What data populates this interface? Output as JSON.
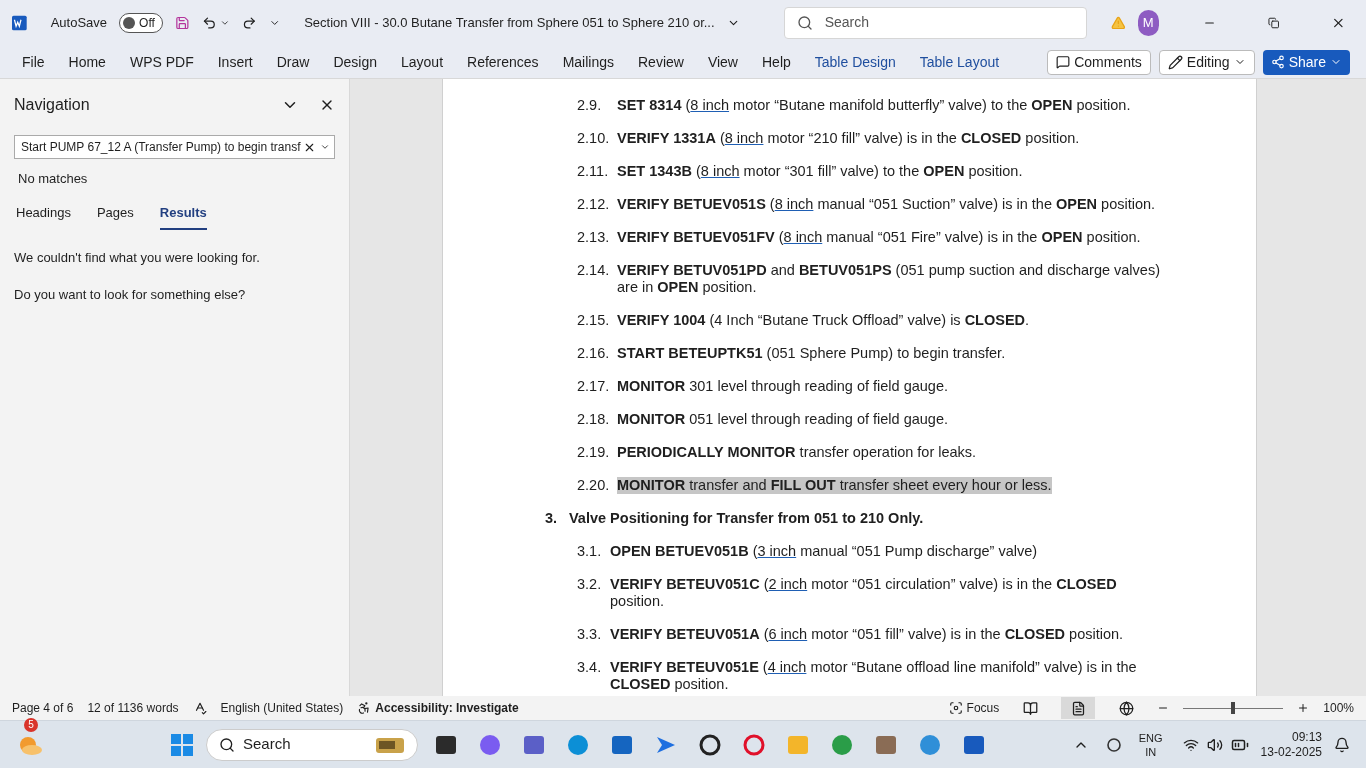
{
  "titlebar": {
    "autosave_label": "AutoSave",
    "autosave_on": false,
    "autosave_state": "Off",
    "title": "Section VIII - 30.0 Butane Transfer from Sphere 051 to Sphere 210 or...",
    "search_placeholder": "Search",
    "avatar": "M"
  },
  "ribbon_tabs": [
    {
      "label": "File",
      "contextual": false
    },
    {
      "label": "Home",
      "contextual": false
    },
    {
      "label": "WPS PDF",
      "contextual": false
    },
    {
      "label": "Insert",
      "contextual": false
    },
    {
      "label": "Draw",
      "contextual": false
    },
    {
      "label": "Design",
      "contextual": false
    },
    {
      "label": "Layout",
      "contextual": false
    },
    {
      "label": "References",
      "contextual": false
    },
    {
      "label": "Mailings",
      "contextual": false
    },
    {
      "label": "Review",
      "contextual": false
    },
    {
      "label": "View",
      "contextual": false
    },
    {
      "label": "Help",
      "contextual": false
    },
    {
      "label": "Table Design",
      "contextual": true
    },
    {
      "label": "Table Layout",
      "contextual": true
    }
  ],
  "ribbon_buttons": {
    "comments": "Comments",
    "editing": "Editing",
    "share": "Share"
  },
  "navigation": {
    "title": "Navigation",
    "search_value": "Start PUMP 67_12 A (Transfer Pump) to begin transf",
    "status": "No matches",
    "tabs": [
      {
        "label": "Headings",
        "selected": false
      },
      {
        "label": "Pages",
        "selected": false
      },
      {
        "label": "Results",
        "selected": true
      }
    ],
    "messages": [
      "We couldn't find what you were looking for.",
      "Do you want to look for something else?"
    ]
  },
  "document": {
    "steps": [
      {
        "number": "2.9.",
        "highlighted": false,
        "segments": [
          {
            "t": "SET 8314",
            "bold": true,
            "underline": false
          },
          {
            "t": " (",
            "bold": false,
            "underline": false
          },
          {
            "t": "8 inch",
            "bold": false,
            "underline": true
          },
          {
            "t": " motor “Butane manifold butterfly” valve) to the ",
            "bold": false,
            "underline": false
          },
          {
            "t": "OPEN",
            "bold": true,
            "underline": false
          },
          {
            "t": " position.",
            "bold": false,
            "underline": false
          }
        ]
      },
      {
        "number": "2.10.",
        "highlighted": false,
        "segments": [
          {
            "t": "VERIFY 1331A",
            "bold": true,
            "underline": false
          },
          {
            "t": " (",
            "bold": false,
            "underline": false
          },
          {
            "t": "8 inch",
            "bold": false,
            "underline": true
          },
          {
            "t": " motor “210 fill” valve) is in the ",
            "bold": false,
            "underline": false
          },
          {
            "t": "CLOSED",
            "bold": true,
            "underline": false
          },
          {
            "t": " position.",
            "bold": false,
            "underline": false
          }
        ]
      },
      {
        "number": "2.11.",
        "highlighted": false,
        "segments": [
          {
            "t": "SET 1343B",
            "bold": true,
            "underline": false
          },
          {
            "t": " (",
            "bold": false,
            "underline": false
          },
          {
            "t": "8 inch",
            "bold": false,
            "underline": true
          },
          {
            "t": " motor “301 fill” valve) to the ",
            "bold": false,
            "underline": false
          },
          {
            "t": "OPEN",
            "bold": true,
            "underline": false
          },
          {
            "t": " position.",
            "bold": false,
            "underline": false
          }
        ]
      },
      {
        "number": "2.12.",
        "highlighted": false,
        "segments": [
          {
            "t": "VERIFY BETUEV051S",
            "bold": true,
            "underline": false
          },
          {
            "t": " (",
            "bold": false,
            "underline": false
          },
          {
            "t": "8 inch",
            "bold": false,
            "underline": true
          },
          {
            "t": " manual “051 Suction” valve) is in the ",
            "bold": false,
            "underline": false
          },
          {
            "t": "OPEN",
            "bold": true,
            "underline": false
          },
          {
            "t": " position.",
            "bold": false,
            "underline": false
          }
        ]
      },
      {
        "number": "2.13.",
        "highlighted": false,
        "segments": [
          {
            "t": "VERIFY BETUEV051FV",
            "bold": true,
            "underline": false
          },
          {
            "t": " (",
            "bold": false,
            "underline": false
          },
          {
            "t": "8 inch",
            "bold": false,
            "underline": true
          },
          {
            "t": " manual “051 Fire” valve) is in the ",
            "bold": false,
            "underline": false
          },
          {
            "t": "OPEN",
            "bold": true,
            "underline": false
          },
          {
            "t": " position.",
            "bold": false,
            "underline": false
          }
        ]
      },
      {
        "number": "2.14.",
        "highlighted": false,
        "segments": [
          {
            "t": "VERIFY BETUV051PD",
            "bold": true,
            "underline": false
          },
          {
            "t": " and ",
            "bold": false,
            "underline": false
          },
          {
            "t": "BETUV051PS",
            "bold": true,
            "underline": false
          },
          {
            "t": " (051 pump suction and discharge valves) are in ",
            "bold": false,
            "underline": false
          },
          {
            "t": "OPEN",
            "bold": true,
            "underline": false
          },
          {
            "t": " position.",
            "bold": false,
            "underline": false
          }
        ]
      },
      {
        "number": "2.15.",
        "highlighted": false,
        "segments": [
          {
            "t": "VERIFY 1004",
            "bold": true,
            "underline": false
          },
          {
            "t": " (4 Inch “Butane Truck Offload” valve) is ",
            "bold": false,
            "underline": false
          },
          {
            "t": "CLOSED",
            "bold": true,
            "underline": false
          },
          {
            "t": ".",
            "bold": false,
            "underline": false
          }
        ]
      },
      {
        "number": "2.16.",
        "highlighted": false,
        "segments": [
          {
            "t": "START BETEUPTK51",
            "bold": true,
            "underline": false
          },
          {
            "t": " (051 Sphere Pump) to begin transfer.",
            "bold": false,
            "underline": false
          }
        ]
      },
      {
        "number": "2.17.",
        "highlighted": false,
        "segments": [
          {
            "t": "MONITOR",
            "bold": true,
            "underline": false
          },
          {
            "t": " 301 level through reading of field gauge.",
            "bold": false,
            "underline": false
          }
        ]
      },
      {
        "number": "2.18.",
        "highlighted": false,
        "segments": [
          {
            "t": "MONITOR",
            "bold": true,
            "underline": false
          },
          {
            "t": " 051 level through reading of field gauge.",
            "bold": false,
            "underline": false
          }
        ]
      },
      {
        "number": "2.19.",
        "highlighted": false,
        "segments": [
          {
            "t": "PERIODICALLY MONITOR",
            "bold": true,
            "underline": false
          },
          {
            "t": " transfer operation for leaks.",
            "bold": false,
            "underline": false
          }
        ]
      },
      {
        "number": "2.20.",
        "highlighted": true,
        "segments": [
          {
            "t": "MONITOR",
            "bold": true,
            "underline": false
          },
          {
            "t": " transfer and ",
            "bold": false,
            "underline": false
          },
          {
            "t": "FILL OUT",
            "bold": true,
            "underline": false
          },
          {
            "t": " transfer sheet every hour or less.",
            "bold": false,
            "underline": false
          }
        ]
      }
    ],
    "section": {
      "number": "3.",
      "title": "Valve Positioning for Transfer from 051 to 210 Only."
    },
    "section_steps": [
      {
        "number": "3.1.",
        "highlighted": false,
        "segments": [
          {
            "t": "OPEN BETUEV051B",
            "bold": true,
            "underline": false
          },
          {
            "t": " (",
            "bold": false,
            "underline": false
          },
          {
            "t": "3 inch",
            "bold": false,
            "underline": true
          },
          {
            "t": " manual “051 Pump discharge” valve)",
            "bold": false,
            "underline": false
          }
        ]
      },
      {
        "number": "3.2.",
        "highlighted": false,
        "segments": [
          {
            "t": "VERIFY BETEUV051C",
            "bold": true,
            "underline": false
          },
          {
            "t": " (",
            "bold": false,
            "underline": false
          },
          {
            "t": "2 inch",
            "bold": false,
            "underline": true
          },
          {
            "t": " motor “051 circulation” valve) is in the ",
            "bold": false,
            "underline": false
          },
          {
            "t": "CLOSED",
            "bold": true,
            "underline": false
          },
          {
            "t": " position.",
            "bold": false,
            "underline": false
          }
        ]
      },
      {
        "number": "3.3.",
        "highlighted": false,
        "segments": [
          {
            "t": "VERIFY BETEUV051A",
            "bold": true,
            "underline": false
          },
          {
            "t": " (",
            "bold": false,
            "underline": false
          },
          {
            "t": "6 inch",
            "bold": false,
            "underline": true
          },
          {
            "t": " motor “051 fill” valve) is in the ",
            "bold": false,
            "underline": false
          },
          {
            "t": "CLOSED",
            "bold": true,
            "underline": false
          },
          {
            "t": " position.",
            "bold": false,
            "underline": false
          }
        ]
      },
      {
        "number": "3.4.",
        "highlighted": false,
        "segments": [
          {
            "t": "VERIFY BETEUV051E",
            "bold": true,
            "underline": false
          },
          {
            "t": " (",
            "bold": false,
            "underline": false
          },
          {
            "t": "4 inch",
            "bold": false,
            "underline": true
          },
          {
            "t": " motor “Butane offload line manifold” valve) is in the ",
            "bold": false,
            "underline": false
          },
          {
            "t": "CLOSED",
            "bold": true,
            "underline": false
          },
          {
            "t": " position.",
            "bold": false,
            "underline": false
          }
        ]
      }
    ]
  },
  "status_bar": {
    "page": "Page 4 of 6",
    "words": "12 of 1136 words",
    "language": "English (United States)",
    "accessibility": "Accessibility: Investigate",
    "focus": "Focus",
    "views": [
      {
        "kind": "read",
        "selected": false
      },
      {
        "kind": "print",
        "selected": true
      },
      {
        "kind": "web",
        "selected": false
      }
    ],
    "zoom": {
      "level": 0.5,
      "reading": "100%"
    }
  },
  "taskbar": {
    "weather_badge": "5",
    "search_placeholder": "Search",
    "language": "ENG",
    "region": "IN",
    "time": "09:13",
    "date": "13-02-2025"
  }
}
